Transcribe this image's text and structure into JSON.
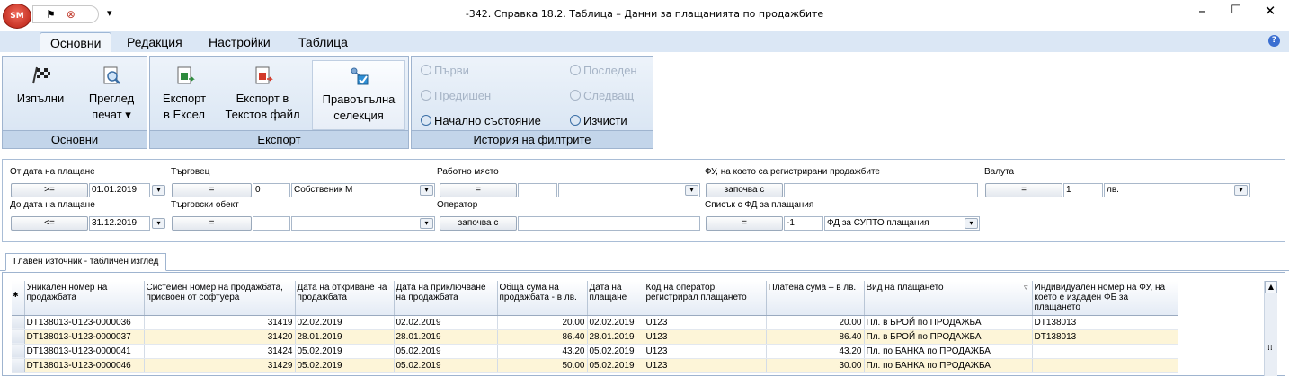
{
  "app": {
    "logo": "SM",
    "window_title": "-342. Справка 18.2. Таблица – Данни за плащанията по продажбите",
    "controls": {
      "minimize": "–",
      "maximize": "☐",
      "close": "✕"
    }
  },
  "qat": {
    "icon1": "flag-icon",
    "icon2": "stop-icon",
    "dropdown": "▾"
  },
  "tabs": [
    "Основни",
    "Редакция",
    "Настройки",
    "Таблица"
  ],
  "ribbon": {
    "groups": {
      "main": {
        "label": "Основни",
        "buttons": [
          {
            "line1": "Изпълни",
            "line2": ""
          },
          {
            "line1": "Преглед",
            "line2": "печат ▾"
          }
        ]
      },
      "export": {
        "label": "Експорт",
        "buttons": [
          {
            "line1": "Експорт",
            "line2": "в Ексел"
          },
          {
            "line1": "Експорт в",
            "line2": "Текстов файл"
          },
          {
            "line1": "Правоъгълна",
            "line2": "селекция"
          }
        ]
      },
      "history": {
        "label": "История на филтрите",
        "first": "Първи",
        "last": "Последен",
        "prev": "Предишен",
        "next": "Следващ",
        "reset": "Начално състояние",
        "clear": "Изчисти"
      }
    }
  },
  "filters": {
    "date_from": {
      "label": "От дата на плащане",
      "op": ">=",
      "value": "01.01.2019"
    },
    "date_to": {
      "label": "До дата на плащане",
      "op": "<=",
      "value": "31.12.2019"
    },
    "merchant": {
      "label": "Търговец",
      "op": "=",
      "code": "0",
      "value": "Собственик М"
    },
    "site": {
      "label": "Търговски обект",
      "op": "=",
      "code": "",
      "value": ""
    },
    "workplace": {
      "label": "Работно място",
      "op": "=",
      "code": "",
      "value": ""
    },
    "operator": {
      "label": "Оператор",
      "op": "започва с",
      "value": ""
    },
    "fd_device": {
      "label": "ФУ, на което са регистрирани продажбите",
      "op": "започва с",
      "value": ""
    },
    "fd_list": {
      "label": "Списък с ФД за плащания",
      "op": "=",
      "code": "-1",
      "value": "ФД за СУПТО плащания"
    },
    "currency": {
      "label": "Валута",
      "op": "=",
      "code": "1",
      "value": "лв."
    }
  },
  "source_tab": "Главен източник - табличен изглед",
  "grid": {
    "columns": [
      "Уникален номер на продажбата",
      "Системен номер на продажбата, присвоен от софтуера",
      "Дата на откриване на продажбата",
      "Дата на приключване на продажбата",
      "Обща сума на продажбата - в лв.",
      "Дата на плащане",
      "Код на оператор, регистрирал плащането",
      "Платена сума – в лв.",
      "Вид на плащането",
      "Индивидуален номер на ФУ, на което е издаден ФБ за плащането"
    ],
    "rows": [
      [
        "DT138013-U123-0000036",
        "31419",
        "02.02.2019",
        "02.02.2019",
        "20.00",
        "02.02.2019",
        "U123",
        "20.00",
        "Пл. в БРОЙ по ПРОДАЖБА",
        "DT138013"
      ],
      [
        "DT138013-U123-0000037",
        "31420",
        "28.01.2019",
        "28.01.2019",
        "86.40",
        "28.01.2019",
        "U123",
        "86.40",
        "Пл. в БРОЙ по ПРОДАЖБА",
        "DT138013"
      ],
      [
        "DT138013-U123-0000041",
        "31424",
        "05.02.2019",
        "05.02.2019",
        "43.20",
        "05.02.2019",
        "U123",
        "43.20",
        "Пл. по БАНКА по ПРОДАЖБА",
        ""
      ],
      [
        "DT138013-U123-0000046",
        "31429",
        "05.02.2019",
        "05.02.2019",
        "50.00",
        "05.02.2019",
        "U123",
        "30.00",
        "Пл. по БАНКА по ПРОДАЖБА",
        ""
      ]
    ]
  }
}
